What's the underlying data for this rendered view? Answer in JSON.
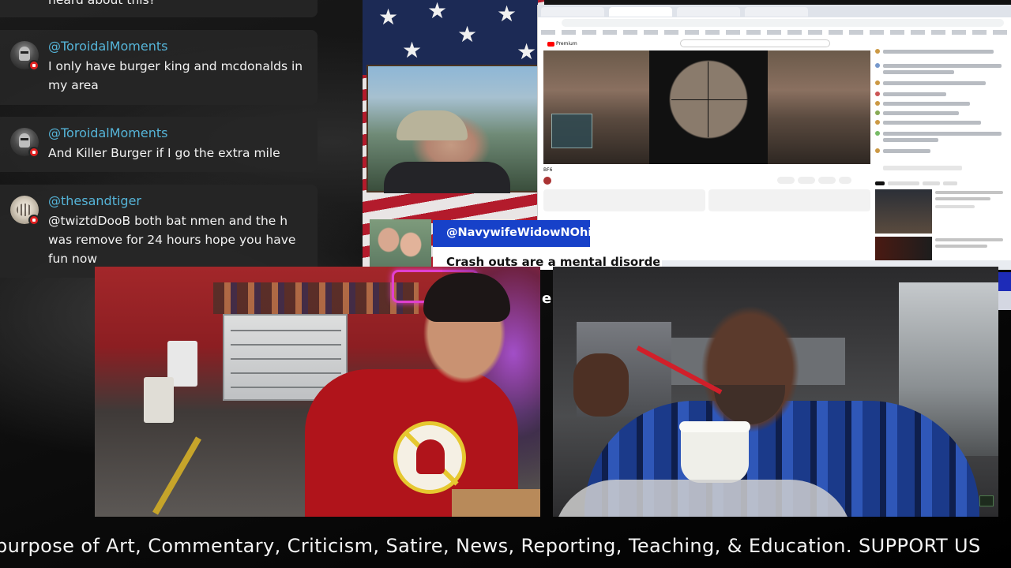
{
  "chat": {
    "partial_top": "heard about this?",
    "messages": [
      {
        "author": "@ToroidalMoments",
        "text": "I only have burger king and mcdonalds in my area",
        "avatar": "knight-avatar"
      },
      {
        "author": "@ToroidalMoments",
        "text": "And Killer Burger if I go the extra mile",
        "avatar": "knight-avatar"
      },
      {
        "author": "@thesandtiger",
        "text": "@twiztdDooB both bat nmen and the h was remove for 24 hours hope you have fun now",
        "avatar": "tiger-avatar"
      }
    ]
  },
  "screen_share": {
    "handle": "@NavywifeWidowNOhio",
    "quote": "Crash outs are a mental disorder Bill",
    "side_strip_char": "e",
    "video_title": "BF6",
    "yt_logo": "Premium"
  },
  "ticker": {
    "text": "purpose of Art, Commentary, Criticism, Satire, News, Reporting, Teaching, & Education. SUPPORT US"
  },
  "colors": {
    "author_link": "#55b4d8",
    "chat_bg": "#262626",
    "handle_box": "#1741c9",
    "shirt_red": "#b0141b"
  }
}
